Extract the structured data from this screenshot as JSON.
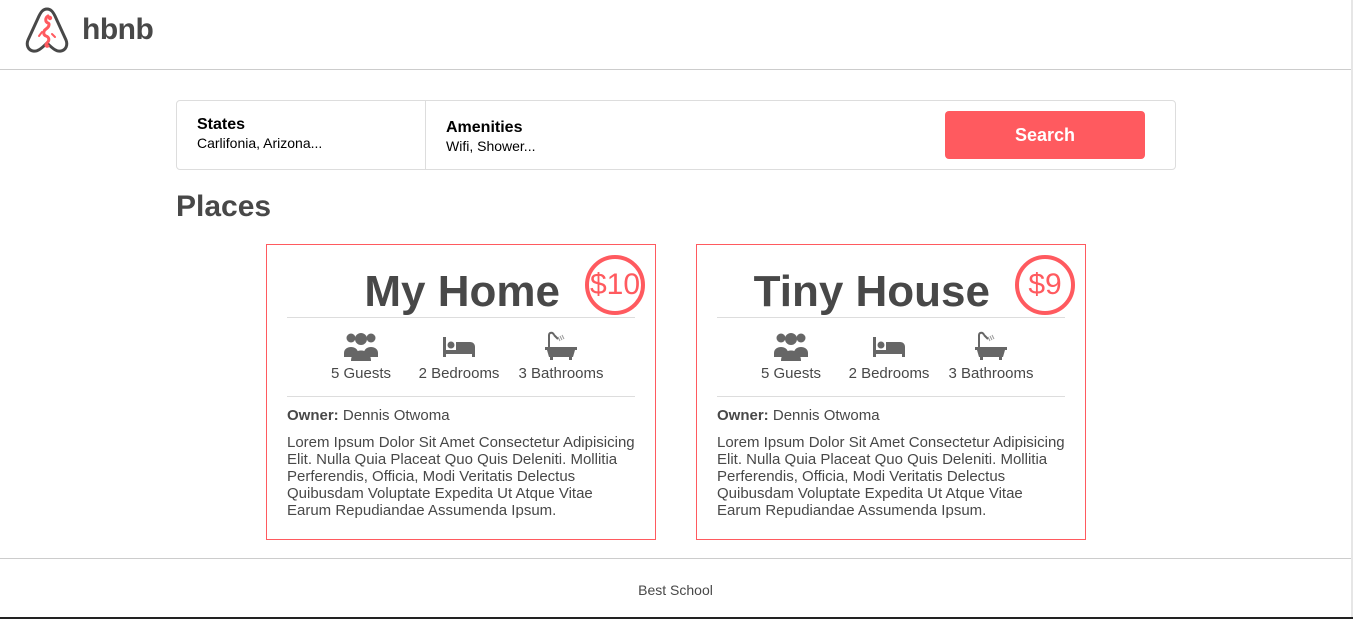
{
  "brand": {
    "name": "hbnb",
    "accent": "#ff5a5f"
  },
  "filters": {
    "states": {
      "title": "States",
      "value": "Carlifonia, Arizona..."
    },
    "amenities": {
      "title": "Amenities",
      "value": "Wifi, Shower..."
    },
    "search_label": "Search"
  },
  "places": {
    "title": "Places",
    "items": [
      {
        "name": "My Home",
        "price": "$10",
        "guests": "5 Guests",
        "bedrooms": "2 Bedrooms",
        "bathrooms": "3 Bathrooms",
        "owner_label": "Owner:",
        "owner": "Dennis Otwoma",
        "description": "Lorem Ipsum Dolor Sit Amet Consectetur Adipisicing Elit. Nulla Quia Placeat Quo Quis Deleniti. Mollitia Perferendis, Officia, Modi Veritatis Delectus Quibusdam Voluptate Expedita Ut Atque Vitae Earum Repudiandae Assumenda Ipsum."
      },
      {
        "name": "Tiny House",
        "price": "$9",
        "guests": "5 Guests",
        "bedrooms": "2 Bedrooms",
        "bathrooms": "3 Bathrooms",
        "owner_label": "Owner:",
        "owner": "Dennis Otwoma",
        "description": "Lorem Ipsum Dolor Sit Amet Consectetur Adipisicing Elit. Nulla Quia Placeat Quo Quis Deleniti. Mollitia Perferendis, Officia, Modi Veritatis Delectus Quibusdam Voluptate Expedita Ut Atque Vitae Earum Repudiandae Assumenda Ipsum."
      }
    ]
  },
  "icons": {
    "logo": "hbnb-logo-icon",
    "guests": "guests-icon",
    "bed": "bed-icon",
    "bath": "bathtub-icon"
  },
  "footer": {
    "text": "Best School"
  }
}
